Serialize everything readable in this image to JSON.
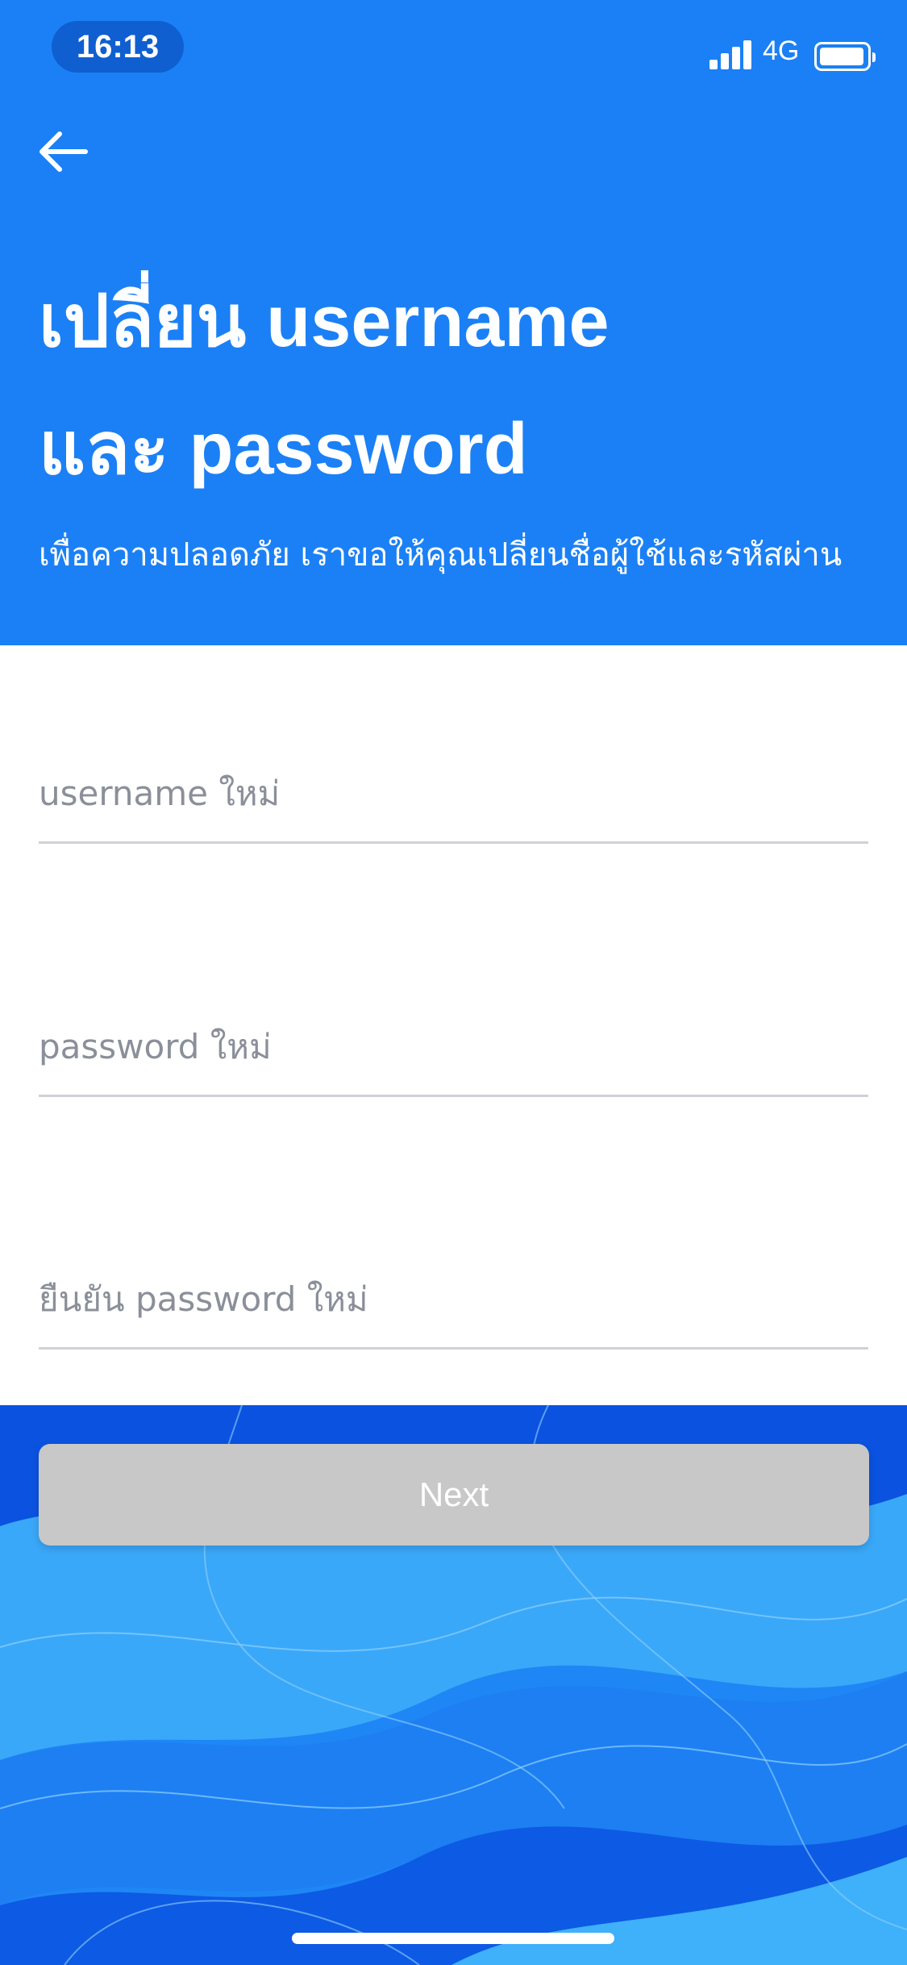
{
  "status_bar": {
    "time": "16:13",
    "network": "4G"
  },
  "header": {
    "title_line1": "เปลี่ยน username",
    "title_line2": "และ password",
    "subtitle": "เพื่อความปลอดภัย เราขอให้คุณเปลี่ยนชื่อผู้ใช้และรหัสผ่าน"
  },
  "form": {
    "username_placeholder": "username ใหม่",
    "password_placeholder": "password ใหม่",
    "confirm_placeholder": "ยืนยัน password ใหม่",
    "username_value": "",
    "password_value": "",
    "confirm_value": ""
  },
  "actions": {
    "next_label": "Next",
    "next_enabled": false
  },
  "colors": {
    "header_bg": "#1b80f5",
    "button_disabled": "#c8c8c8",
    "wave_dark": "#0b52e0",
    "wave_light": "#3aa8f8"
  }
}
